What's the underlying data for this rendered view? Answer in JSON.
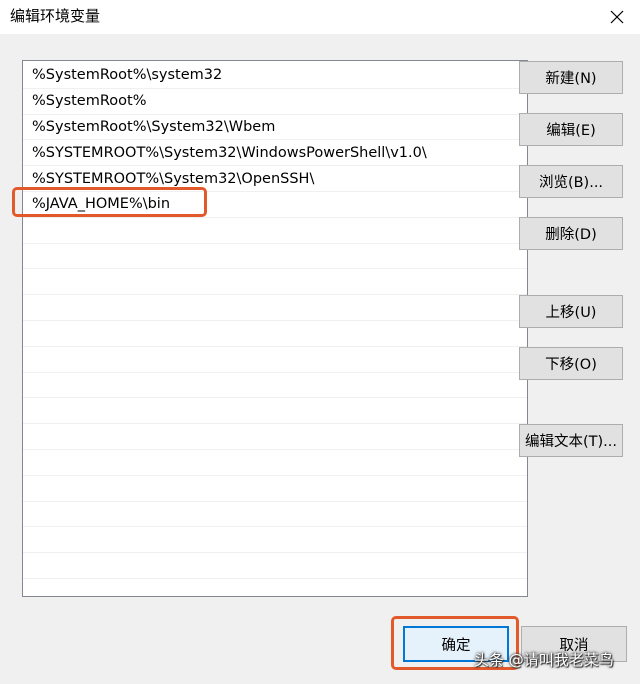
{
  "window": {
    "title": "编辑环境变量",
    "close_icon": "close-icon"
  },
  "path_list": {
    "items": [
      "%SystemRoot%\\system32",
      "%SystemRoot%",
      "%SystemRoot%\\System32\\Wbem",
      "%SYSTEMROOT%\\System32\\WindowsPowerShell\\v1.0\\",
      "%SYSTEMROOT%\\System32\\OpenSSH\\",
      "%JAVA_HOME%\\bin"
    ],
    "highlighted_index": 5
  },
  "buttons": {
    "new": "新建(N)",
    "edit": "编辑(E)",
    "browse": "浏览(B)...",
    "delete": "删除(D)",
    "move_up": "上移(U)",
    "move_down": "下移(O)",
    "edit_text": "编辑文本(T)...",
    "ok": "确定",
    "cancel": "取消"
  },
  "watermark": "头条 @请叫我老菜鸟",
  "colors": {
    "annotation": "#e25a2b",
    "focus": "#0078d7",
    "dialog_bg": "#f0f0f0"
  }
}
